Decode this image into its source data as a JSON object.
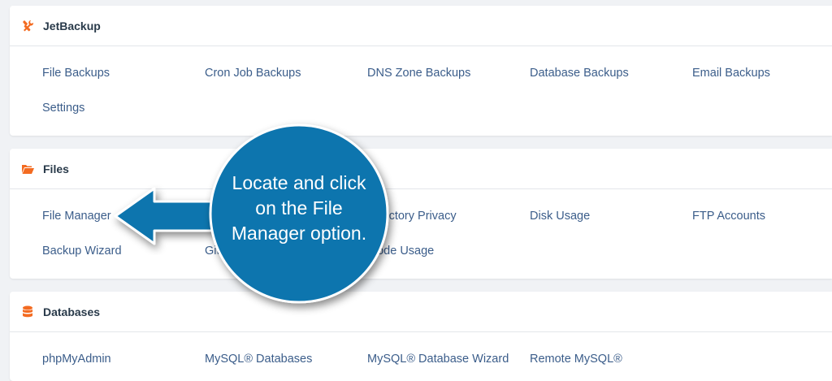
{
  "sections": [
    {
      "title": "JetBackup",
      "items": [
        "File Backups",
        "Cron Job Backups",
        "DNS Zone Backups",
        "Database Backups",
        "Email Backups",
        "Settings"
      ]
    },
    {
      "title": "Files",
      "items": [
        "File Manager",
        "Directory Privacy",
        "Disk Usage",
        "FTP Accounts",
        "Backup Wizard",
        "Git",
        "Inode Usage"
      ]
    },
    {
      "title": "Databases",
      "items": [
        "phpMyAdmin",
        "MySQL® Databases",
        "MySQL® Database Wizard",
        "Remote MySQL®"
      ]
    }
  ],
  "callout": {
    "line1": "Locate and click",
    "line2": "on the File",
    "line3": "Manager option."
  },
  "colors": {
    "accent": "#f36b21",
    "link": "#3b5d8a",
    "callout": "#0f74ae"
  }
}
